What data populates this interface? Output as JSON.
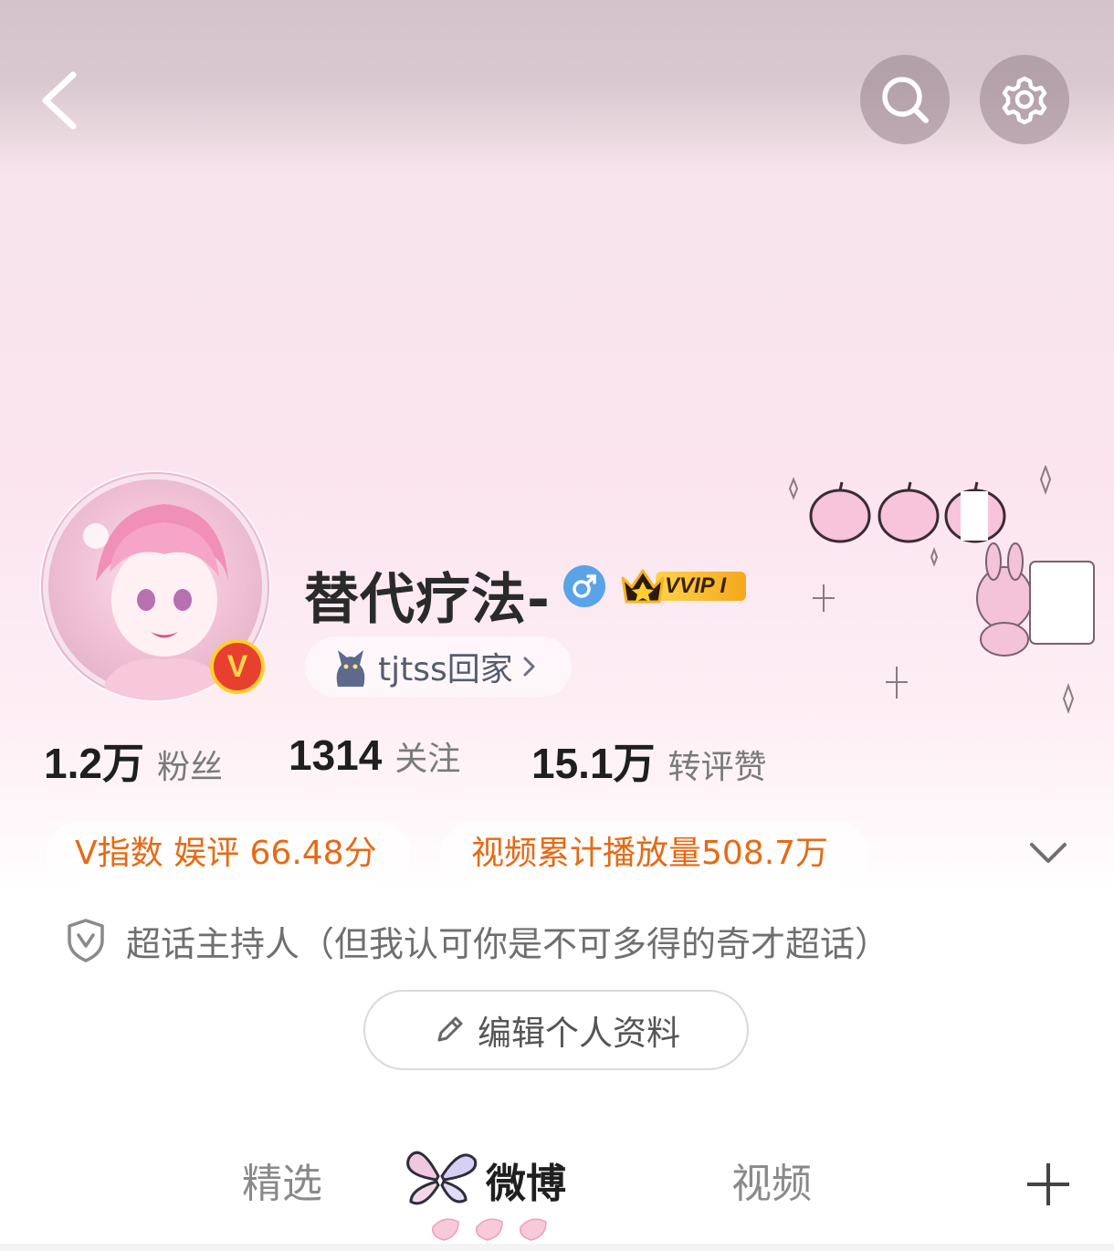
{
  "profile": {
    "username": "替代疗法-",
    "vip_label": "VVIP I",
    "super_topic_tag": "tjtss回家"
  },
  "stats": [
    {
      "value": "1.2万",
      "label": "粉丝"
    },
    {
      "value": "1314",
      "label": "关注"
    },
    {
      "value": "15.1万",
      "label": "转评赞"
    }
  ],
  "badges": {
    "v_index": "V指数 娱评 66.48分",
    "video_plays": "视频累计播放量508.7万"
  },
  "role": {
    "text": "超话主持人（但我认可你是不可多得的奇才超话）"
  },
  "edit_profile": {
    "label": "编辑个人资料"
  },
  "tabs": [
    {
      "label": "精选"
    },
    {
      "label": "微博",
      "active": true
    },
    {
      "label": "视频"
    }
  ],
  "colors": {
    "accent_orange": "#e66a14",
    "header_pink": "#fbe4ee",
    "verify_red": "#e8402f",
    "gender_blue": "#5aa3e8"
  }
}
